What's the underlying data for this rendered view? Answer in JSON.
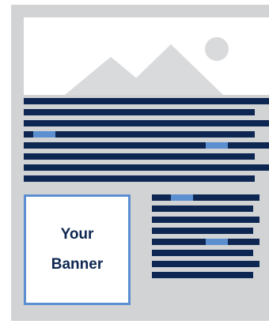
{
  "banner": {
    "line1": "Your",
    "line2": "Banner"
  },
  "colors": {
    "frame": "#d2d3d5",
    "text_line": "#0e2752",
    "highlight": "#5b8fd0",
    "hero_shape": "#d9dadc",
    "background": "#ffffff"
  },
  "icons": {
    "hero": "mountain-sun-placeholder-icon"
  }
}
